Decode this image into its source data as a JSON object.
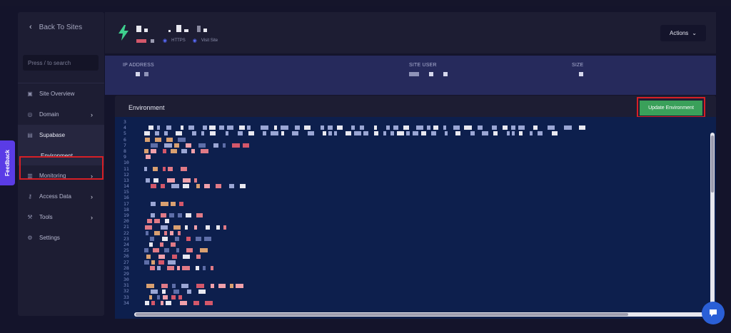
{
  "sidebar": {
    "back_label": "Back To Sites",
    "search_placeholder": "Press / to search",
    "items": [
      {
        "label": "Site Overview"
      },
      {
        "label": "Domain"
      },
      {
        "label": "Supabase"
      },
      {
        "label": "Environment"
      },
      {
        "label": "Monitoring"
      },
      {
        "label": "Access Data"
      },
      {
        "label": "Tools"
      },
      {
        "label": "Settings"
      }
    ]
  },
  "feedback_label": "Feedback",
  "header": {
    "https_label": "HTTPS",
    "visit_label": "Visit Site",
    "actions_label": "Actions"
  },
  "info": {
    "ip_label": "IP ADDRESS",
    "user_label": "SITE USER",
    "size_label": "SIZE"
  },
  "editor": {
    "title": "Environment",
    "update_label": "Update Environment",
    "line_numbers": [
      "3",
      "4",
      "5",
      "6",
      "7",
      "8",
      "9",
      "10",
      "11",
      "12",
      "13",
      "14",
      "15",
      "16",
      "17",
      "18",
      "19",
      "20",
      "21",
      "22",
      "23",
      "24",
      "25",
      "26",
      "27",
      "28",
      "29",
      "30",
      "31",
      "32",
      "33",
      "34"
    ]
  },
  "colors": {
    "accent_green": "#3aa05a",
    "highlight_red": "#d61f26",
    "feedback_purple": "#5a3ce6",
    "editor_bg": "#0d1f4d"
  }
}
